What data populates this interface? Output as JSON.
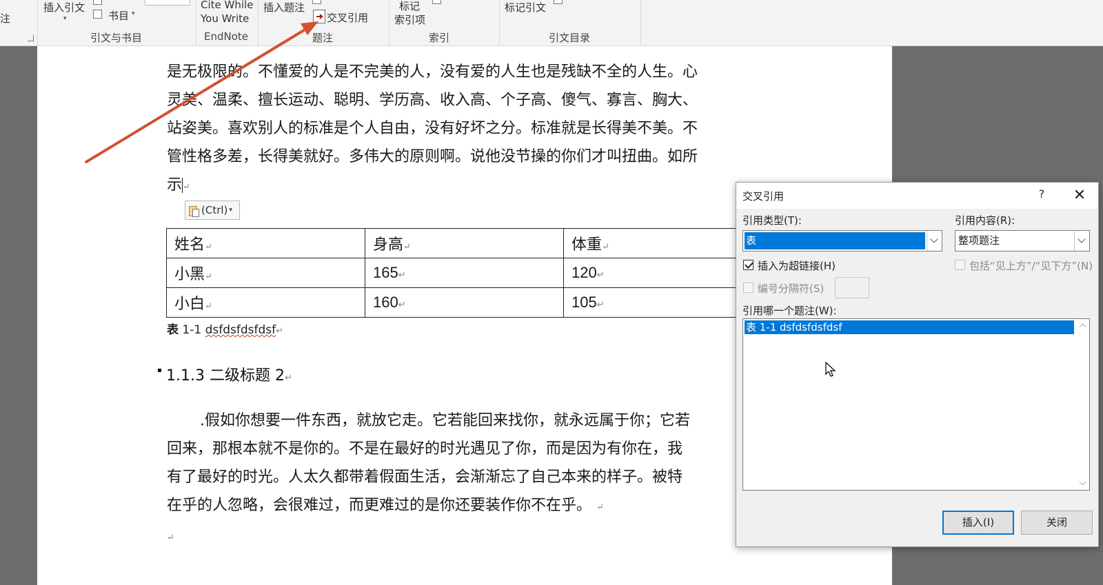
{
  "ribbon": {
    "left_top_text": "注",
    "insert_citation_label": "插入引文",
    "bibliography_label": "书目",
    "group_citations": "引文与书目",
    "cite_while_line1": "Cite While",
    "cite_while_line2": "You Write",
    "group_endnote": "EndNote",
    "insert_caption_label": "插入题注",
    "cross_reference_label": "交叉引用",
    "group_captions": "题注",
    "mark_entry_line1": "标记",
    "mark_entry_line2": "索引项",
    "group_index": "索引",
    "mark_citation_label": "标记引文",
    "group_toa": "引文目录"
  },
  "document": {
    "para1": [
      "是无极限的。不懂爱的人是不完美的人，没有爱的人生也是残缺不全的人生。心",
      "灵美、温柔、擅长运动、聪明、学历高、收入高、个子高、傻气、寡言、胸大、",
      "站姿美。喜欢别人的标准是个人自由，没有好坏之分。标准就是长得美不美。不",
      "管性格多差，长得美就好。多伟大的原则啊。说他没节操的你们才叫扭曲。如所",
      "示"
    ],
    "paste_options_label": "(Ctrl)",
    "table": {
      "header": [
        "姓名",
        "身高",
        "体重"
      ],
      "rows": [
        [
          "小黑",
          "165",
          "120"
        ],
        [
          "小白",
          "160",
          "105"
        ]
      ]
    },
    "caption_prefix": "表",
    "caption_number": "1-1",
    "caption_text": "dsfdsfdsfdsf",
    "heading": "1.1.3 二级标题 2",
    "para2": [
      ".假如你想要一件东西，就放它走。它若能回来找你，就永远属于你；它若",
      "回来，那根本就不是你的。不是在最好的时光遇见了你，而是因为有你在，我",
      "有了最好的时光。人太久都带着假面生活，会渐渐忘了自己本来的样子。被特",
      "在乎的人忽略，会很难过，而更难过的是你还要装作你不在乎。"
    ]
  },
  "dialog": {
    "title": "交叉引用",
    "help": "?",
    "close": "✕",
    "ref_type_label": "引用类型(T):",
    "ref_type_value": "表",
    "ref_content_label": "引用内容(R):",
    "ref_content_value": "整项题注",
    "insert_hyperlink_label": "插入为超链接(H)",
    "insert_hyperlink_checked": true,
    "include_above_below_label": "包括“见上方”/“见下方”(N)",
    "separate_numbers_label": "编号分隔符(S)",
    "which_caption_label": "引用哪一个题注(W):",
    "caption_items": [
      "表 1-1 dsfdsfdsfdsf"
    ],
    "insert_button": "插入(I)",
    "close_button": "关闭"
  },
  "colors": {
    "arrow": "#d2512e",
    "selection": "#0078d7"
  }
}
